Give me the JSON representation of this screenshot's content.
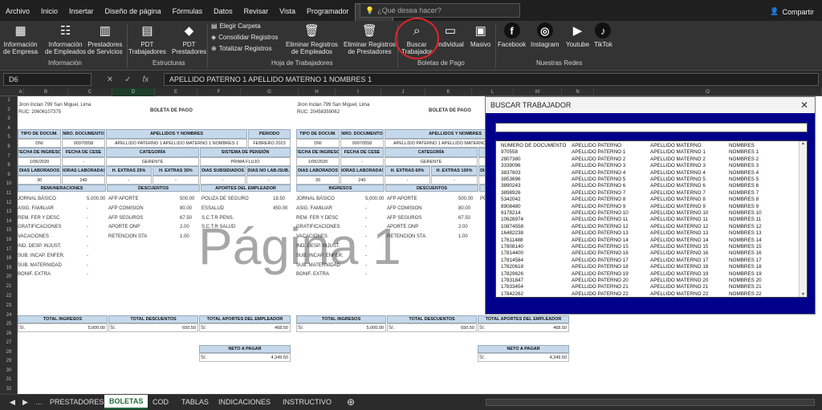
{
  "menu": [
    "Archivo",
    "Inicio",
    "Insertar",
    "Diseño de página",
    "Fórmulas",
    "Datos",
    "Revisar",
    "Vista",
    "Programador",
    "PLAME"
  ],
  "search_placeholder": "¿Qué desea hacer?",
  "share_label": "Compartir",
  "ribbon": {
    "buttons": [
      {
        "label": "Información\nde Empresa",
        "icon": "building-icon"
      },
      {
        "label": "Información\nde Empleados",
        "icon": "employees-icon"
      },
      {
        "label": "Prestadores\nde Servicios",
        "icon": "clipboard-icon"
      },
      {
        "label": "PDT\nTrabajadores",
        "icon": "document-icon"
      },
      {
        "label": "PDT\nPrestadores",
        "icon": "sunat-icon"
      },
      {
        "label": "Eliminar Registros\nde Empleados",
        "icon": "trash-icon"
      },
      {
        "label": "Eliminar Registros\nde Prestadores",
        "icon": "trash-icon"
      },
      {
        "label": "Buscar\nTrabajador",
        "icon": "search-doc-icon"
      },
      {
        "label": "Individual",
        "icon": "pdf-icon"
      },
      {
        "label": "Masivo",
        "icon": "printer-icon"
      },
      {
        "label": "Facebook",
        "icon": "facebook-icon"
      },
      {
        "label": "Instagram",
        "icon": "instagram-icon"
      },
      {
        "label": "Youtube",
        "icon": "youtube-icon"
      },
      {
        "label": "TikTok",
        "icon": "tiktok-icon"
      }
    ],
    "small": [
      "Elegir Carpeta",
      "Consolidar Registros",
      "Totalizar Registros"
    ],
    "groups": [
      "Información",
      "Estructuras",
      "Hoja de Trabajadores",
      "Boletas de Pago",
      "Nuestras Redes"
    ]
  },
  "formula": {
    "name_box": "D6",
    "content": "APELLIDO PATERNO 1 APELLIDO MATERNO 1 NOMBRES 1"
  },
  "columns": [
    "A",
    "B",
    "C",
    "D",
    "E",
    "F",
    "G",
    "H",
    "I",
    "J",
    "K",
    "L",
    "M",
    "N",
    "O"
  ],
  "boleta": {
    "address": "Jiron Inclan 799 San Miguel, Lima",
    "ruc": "RUC: 20606107375",
    "ruc2": "RUC: 20458359062",
    "title": "BOLETA DE PAGO",
    "h_tipo": "TIPO DE DOCUM.",
    "h_nro": "NRO. DOCUMENTO",
    "h_apell": "APELLIDOS Y NOMBRES",
    "h_periodo": "PERIODO",
    "tipo": "DNI",
    "nro": "00970558",
    "nombre": "APELLIDO PATERNO 1 APELLIDO MATERNO 1 NOMBRES 1",
    "periodo": "FEBRERO 2023",
    "h_ingreso": "FECHA DE INGRESO",
    "h_cese": "FECHA DE CESE",
    "h_categoria": "CATEGORÍA",
    "h_pension": "SISTEMA DE PENSIÓN",
    "ingreso": "1/06/2020",
    "cese": "-",
    "categoria": "GERENTE",
    "pension": "PRIMA FLUJO",
    "h_dias": "DIAS LABORADOS",
    "h_horas": "HORAS LABORADAS",
    "h_ext25": "H. EXTRAS 25%",
    "h_ext35": "H. EXTRAS 35%",
    "h_subs": "DIAS SUBSIDIADOS",
    "h_nolab": "DIAS NO LAB./SUB.",
    "h_ext60": "H. EXTRAS 60%",
    "h_ext100": "H. EXTRAS 100%",
    "dias": "30",
    "horas": "240",
    "dash": "-",
    "h_rem": "REMUNERACIONES",
    "h_ingresos": "INGRESOS",
    "h_desc": "DESCUENTOS",
    "h_aportes": "APORTES DEL EMPLEADOR",
    "rem_labels": [
      "JORNAL BÁSICO",
      "ASIG. FAMILIAR",
      "REM. FER Y DESC",
      "GRATIFICACIONES",
      "VACACIONES",
      "IND. DESP. INJUST.",
      "SUB. INCAP. ENFER.",
      "SUB. MATERNIDAD",
      "BONIF. EXTRA"
    ],
    "rem_values": [
      "5,000.00",
      "-",
      "-",
      "-",
      "-",
      "-",
      "-",
      "-",
      "-"
    ],
    "desc_labels": [
      "AFP APORTE",
      "AFP COMISION",
      "AFP SEGUROS",
      "APORTE ONP",
      "RETENCION STA"
    ],
    "desc_values": [
      "500.00",
      "80.00",
      "67.50",
      "2.00",
      "1.00"
    ],
    "ap_labels": [
      "POLIZA DE SEGURO",
      "ESSALUD",
      "S.C.T.R PENS.",
      "S.C.T.R SALUD"
    ],
    "ap_values": [
      "18.50",
      "450.00",
      "",
      ""
    ],
    "h_tot_ing": "TOTAL INGRESOS",
    "h_tot_desc": "TOTAL DESCUENTOS",
    "h_tot_ap": "TOTAL APORTES DEL EMPLEADOR",
    "cur": "S/.",
    "tot_ing": "5,000.00",
    "tot_desc": "650.50",
    "tot_ap": "468.50",
    "h_neto": "NETO A PAGAR",
    "neto": "4,349.50",
    "watermark": "Página 1"
  },
  "dialog": {
    "title": "BUSCAR TRABAJADOR",
    "close": "✕",
    "headers": [
      "NÚMERO DE DOCUMENTO",
      "APELLIDO PATERNO",
      "APELLIDO MATERNO",
      "NOMBRES"
    ],
    "rows": [
      [
        "970558",
        "APELLIDO PATERNO 1",
        "APELLIDO MATERNO 1",
        "NOMBRES 1"
      ],
      [
        "2807380",
        "APELLIDO PATERNO 2",
        "APELLIDO MATERNO 2",
        "NOMBRES 2"
      ],
      [
        "3339096",
        "APELLIDO PATERNO 3",
        "APELLIDO MATERNO 3",
        "NOMBRES 3"
      ],
      [
        "3837603",
        "APELLIDO PATERNO 4",
        "APELLIDO MATERNO 4",
        "NOMBRES 4"
      ],
      [
        "3853696",
        "APELLIDO PATERNO 5",
        "APELLIDO MATERNO 5",
        "NOMBRES 5"
      ],
      [
        "3890243",
        "APELLIDO PATERNO 6",
        "APELLIDO MATERNO 6",
        "NOMBRES 6"
      ],
      [
        "3898926",
        "APELLIDO PATERNO 7",
        "APELLIDO MATERNO 7",
        "NOMBRES 7"
      ],
      [
        "5342042",
        "APELLIDO PATERNO 8",
        "APELLIDO MATERNO 8",
        "NOMBRES 8"
      ],
      [
        "8908480",
        "APELLIDO PATERNO 9",
        "APELLIDO MATERNO 9",
        "NOMBRES 9"
      ],
      [
        "9178214",
        "APELLIDO PATERNO 10",
        "APELLIDO MATERNO 10",
        "NOMBRES 10"
      ],
      [
        "10626974",
        "APELLIDO PATERNO 11",
        "APELLIDO MATERNO 11",
        "NOMBRES 11"
      ],
      [
        "10874558",
        "APELLIDO PATERNO 12",
        "APELLIDO MATERNO 12",
        "NOMBRES 12"
      ],
      [
        "16482238",
        "APELLIDO PATERNO 13",
        "APELLIDO MATERNO 13",
        "NOMBRES 13"
      ],
      [
        "17611488",
        "APELLIDO PATERNO 14",
        "APELLIDO MATERNO 14",
        "NOMBRES 14"
      ],
      [
        "17808140",
        "APELLIDO PATERNO 15",
        "APELLIDO MATERNO 15",
        "NOMBRES 15"
      ],
      [
        "17814400",
        "APELLIDO PATERNO 16",
        "APELLIDO MATERNO 16",
        "NOMBRES 16"
      ],
      [
        "17814584",
        "APELLIDO PATERNO 17",
        "APELLIDO MATERNO 17",
        "NOMBRES 17"
      ],
      [
        "17820618",
        "APELLIDO PATERNO 18",
        "APELLIDO MATERNO 18",
        "NOMBRES 18"
      ],
      [
        "17829626",
        "APELLIDO PATERNO 19",
        "APELLIDO MATERNO 19",
        "NOMBRES 19"
      ],
      [
        "17831847",
        "APELLIDO PATERNO 20",
        "APELLIDO MATERNO 20",
        "NOMBRES 20"
      ],
      [
        "17833454",
        "APELLIDO PATERNO 21",
        "APELLIDO MATERNO 21",
        "NOMBRES 21"
      ],
      [
        "17842262",
        "APELLIDO PATERNO 22",
        "APELLIDO MATERNO 22",
        "NOMBRES 22"
      ]
    ]
  },
  "sheet_tabs": [
    "PRESTADORES",
    "BOLETAS",
    "COD",
    "TABLAS",
    "INDICACIONES",
    "INSTRUCTIVO"
  ],
  "active_tab": "BOLETAS",
  "colors": {
    "accent": "#1e6b3a",
    "dialog_bg": "#00008b",
    "header_blue": "#c6d9ec",
    "highlight": "#e0252a"
  }
}
